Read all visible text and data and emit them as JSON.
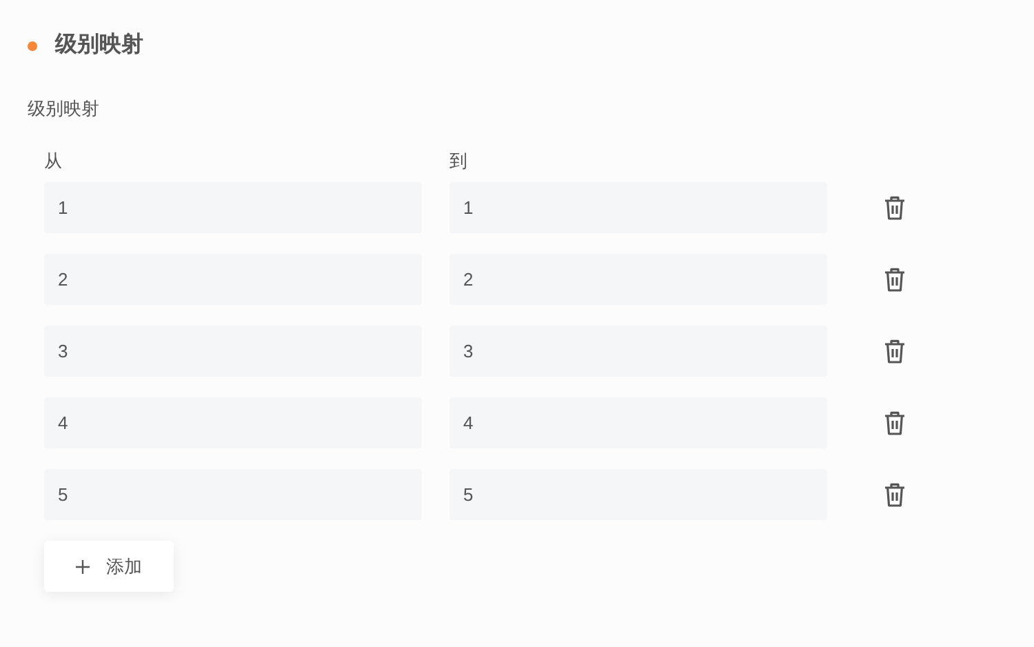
{
  "section": {
    "title": "级别映射"
  },
  "field_label": "级别映射",
  "columns": [
    "从",
    "到"
  ],
  "rows": [
    {
      "from": "1",
      "to": "1"
    },
    {
      "from": "2",
      "to": "2"
    },
    {
      "from": "3",
      "to": "3"
    },
    {
      "from": "4",
      "to": "4"
    },
    {
      "from": "5",
      "to": "5"
    }
  ],
  "add_button": "添加"
}
